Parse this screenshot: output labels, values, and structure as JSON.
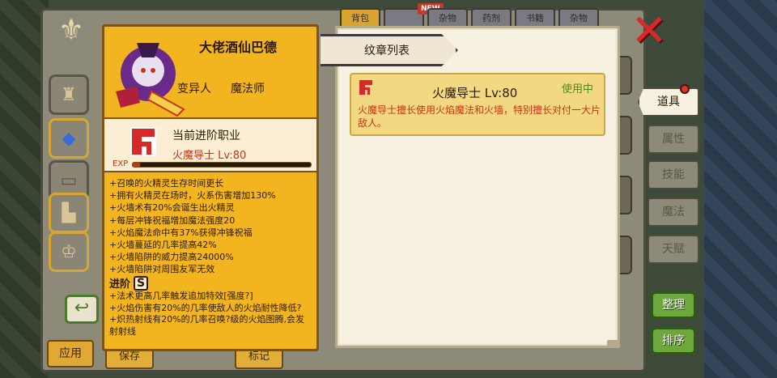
{
  "top_tabs": [
    {
      "label": "背包",
      "active": true
    },
    {
      "label": "",
      "active": false
    },
    {
      "label": "杂物",
      "active": false
    },
    {
      "label": "药剂",
      "active": false
    },
    {
      "label": "书籍",
      "active": false
    },
    {
      "label": "杂物",
      "active": false
    }
  ],
  "new_badge": "NEW",
  "character": {
    "name": "大佬酒仙巴德",
    "race": "变异人",
    "class": "魔法师"
  },
  "profession": {
    "title": "当前进阶职业",
    "level_text": "火魔导士 Lv:80",
    "exp_label": "EXP",
    "exp_progress": 0.04
  },
  "bonuses": [
    "+召唤的火精灵生存时间更长",
    "+拥有火精灵在场时，火系伤害增加130%",
    "+火墙术有20%会诞生出火精灵",
    "+每层冲锋祝福增加魔法强度20",
    "+火焰魔法命中有37%获得冲锋祝福",
    "+火墙蔓延的几率提高42%",
    "+火墙陷阱的威力提高24000%",
    "+火墙陷阱对周围友军无效"
  ],
  "advance": {
    "label": "进阶",
    "grade": "S",
    "items": [
      "+法术更高几率触发追加特效[强度?]",
      "+火焰伤害有20%的几率使敌人的火焰耐性降低?",
      "+炽热射线有20%的几率召唤?级的火焰图腾,会发射射线"
    ]
  },
  "crest_panel": {
    "header": "纹章列表",
    "item": {
      "name": "火魔导士 Lv:80",
      "status": "使用中",
      "description": "火魔导士擅长使用火焰魔法和火墙，特别擅长对付一大片敌人。"
    }
  },
  "side_tabs": [
    {
      "label": "道具",
      "active": true
    },
    {
      "label": "属性",
      "active": false
    },
    {
      "label": "技能",
      "active": false
    },
    {
      "label": "魔法",
      "active": false
    },
    {
      "label": "天赋",
      "active": false
    }
  ],
  "buttons": {
    "sort": "整理",
    "order": "排序",
    "apply": "应用",
    "save": "保存",
    "mark": "标记",
    "reset_icon": "↩"
  },
  "colors": {
    "card_orange": "#f2b51f",
    "accent_red": "#c73418",
    "status_green": "#4c8a1c",
    "close_red": "#d7292a"
  },
  "icons": {
    "close": "close-icon",
    "crest": "fire-mage-crest-icon",
    "reset": "undo-icon"
  }
}
